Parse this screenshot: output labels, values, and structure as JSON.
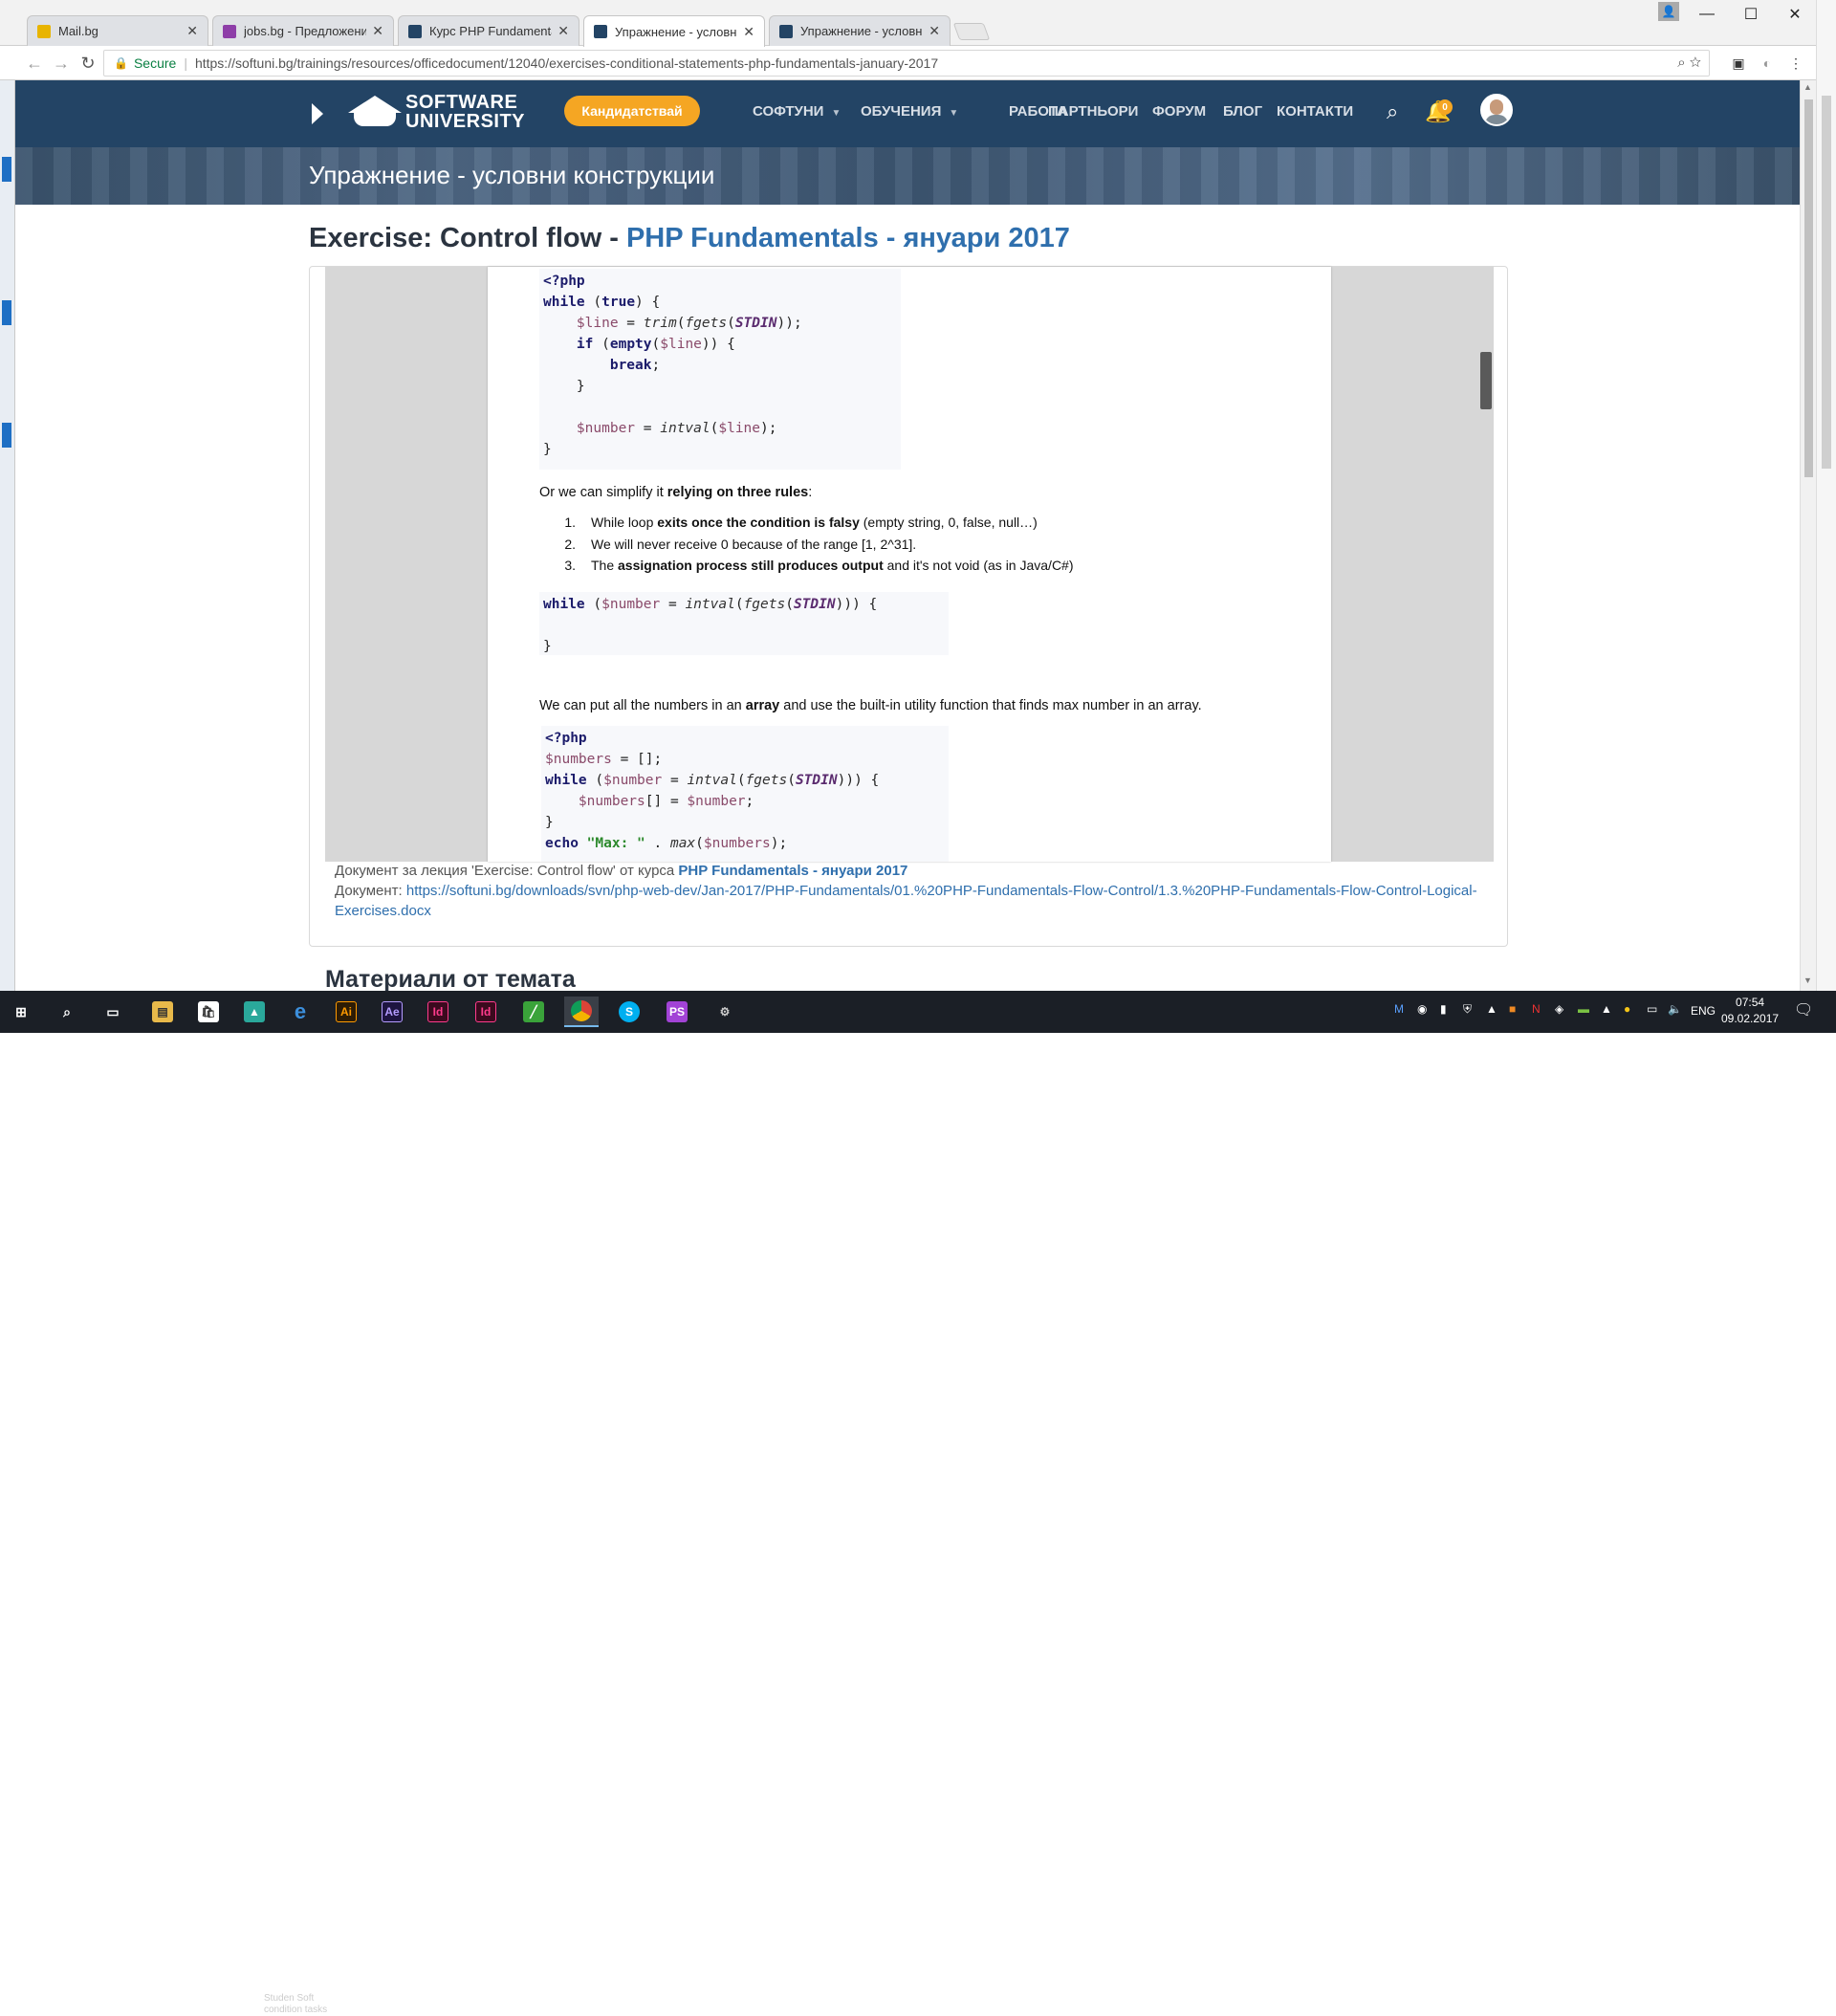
{
  "browser": {
    "tabs": [
      {
        "title": "Mail.bg",
        "color": "#e8b400"
      },
      {
        "title": "jobs.bg - Предложения",
        "color": "#8e3ea8"
      },
      {
        "title": "Курс PHP Fundamentals",
        "color": "#234465"
      },
      {
        "title": "Упражнение - условни",
        "color": "#234465"
      },
      {
        "title": "Упражнение - условни",
        "color": "#234465"
      }
    ],
    "secure_label": "Secure",
    "url": "https://softuni.bg/trainings/resources/officedocument/12040/exercises-conditional-statements-php-fundamentals-january-2017"
  },
  "site": {
    "logo_line1": "SOFTWARE",
    "logo_line2": "UNIVERSITY",
    "cta": "Кандидатствай",
    "menu": [
      "СОФТУНИ",
      "ОБУЧЕНИЯ",
      "РАБОТА",
      "ПАРТНЬОРИ",
      "ФОРУМ",
      "БЛОГ",
      "КОНТАКТИ"
    ],
    "bell_count": "0",
    "banner_title": "Упражнение - условни конструкции",
    "brand_color": "#234465",
    "accent_color": "#f5a623"
  },
  "content": {
    "heading_prefix": "Exercise: Control flow - ",
    "heading_link": "PHP Fundamentals - януари 2017",
    "para1_a": "Or we can simplify it ",
    "para1_b": "relying on three rules",
    "para1_c": ":",
    "rules": [
      {
        "n": "1.",
        "a": "While loop ",
        "b": "exits once the condition is falsy",
        "c": " (empty string, 0, false, null…)"
      },
      {
        "n": "2.",
        "a": "We will never receive 0 because of the range [1, 2^31].",
        "b": "",
        "c": ""
      },
      {
        "n": "3.",
        "a": "The ",
        "b": "assignation process still produces output",
        "c": " and it's not void (as in Java/C#)"
      }
    ],
    "para2_a": "We can put all the numbers in an ",
    "para2_b": "array",
    "para2_c": " and use the built-in utility function that finds max number in an array.",
    "meta_line1_a": "Документ за лекция 'Exercise: Control flow' от курса ",
    "meta_line1_b": "PHP Fundamentals - януари 2017",
    "meta_line2_label": "Документ: ",
    "meta_line2_link": "https://softuni.bg/downloads/svn/php-web-dev/Jan-2017/PHP-Fundamentals/01.%20PHP-Fundamentals-Flow-Control/1.3.%20PHP-Fundamentals-Flow-Control-Logical-Exercises.docx",
    "materials_heading": "Материали от темата"
  },
  "taskbar": {
    "lang": "ENG",
    "time": "07:54",
    "date": "09.02.2017",
    "caption_1": "Studen Soft",
    "caption_2": "condition tasks"
  }
}
